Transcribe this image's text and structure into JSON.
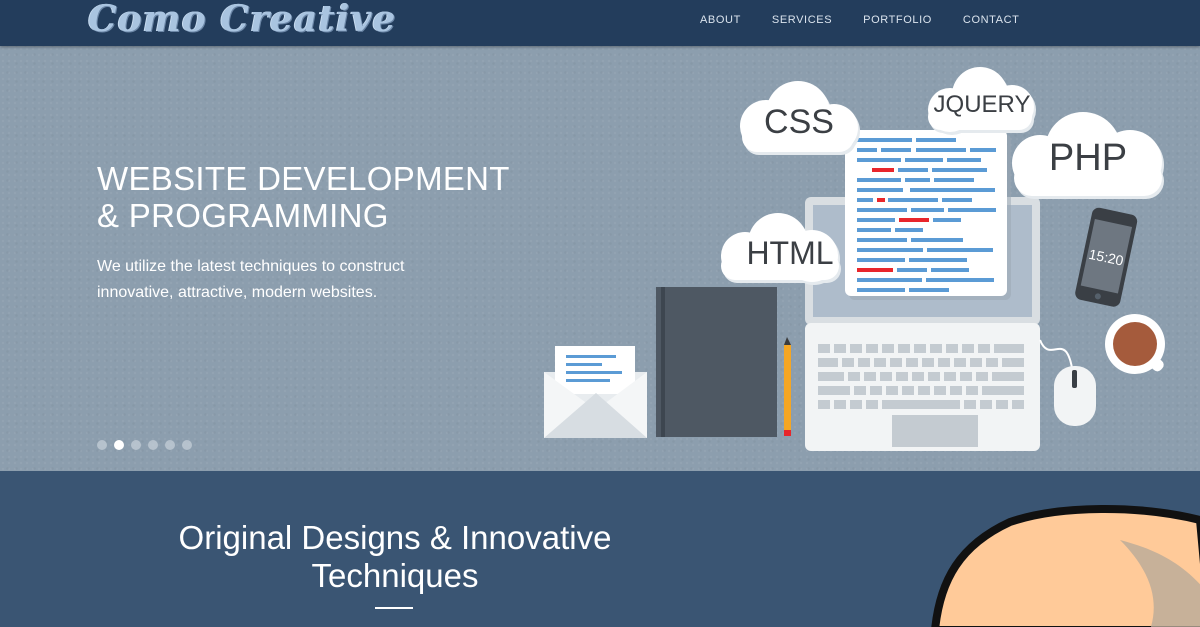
{
  "brand": {
    "logo_text": "Como Creative"
  },
  "nav": {
    "items": [
      {
        "label": "ABOUT"
      },
      {
        "label": "SERVICES"
      },
      {
        "label": "PORTFOLIO"
      },
      {
        "label": "CONTACT"
      }
    ]
  },
  "hero": {
    "title_line1": "WEBSITE DEVELOPMENT",
    "title_line2": "& PROGRAMMING",
    "text_line1": "We utilize the latest techniques to construct",
    "text_line2": "innovative, attractive, modern websites.",
    "slides_count": 6,
    "active_slide": 2,
    "illustration": {
      "cloud_labels": [
        "CSS",
        "JQUERY",
        "PHP",
        "HTML"
      ],
      "phone_time": "15:20"
    }
  },
  "section": {
    "title_line1": "Original Designs & Innovative",
    "title_line2": "Techniques"
  },
  "colors": {
    "navbar": "#233d5c",
    "hero_bg": "#8c9eae",
    "section_bg": "#3a5573",
    "code_blue": "#5b9bd5",
    "code_red": "#e8262b"
  }
}
